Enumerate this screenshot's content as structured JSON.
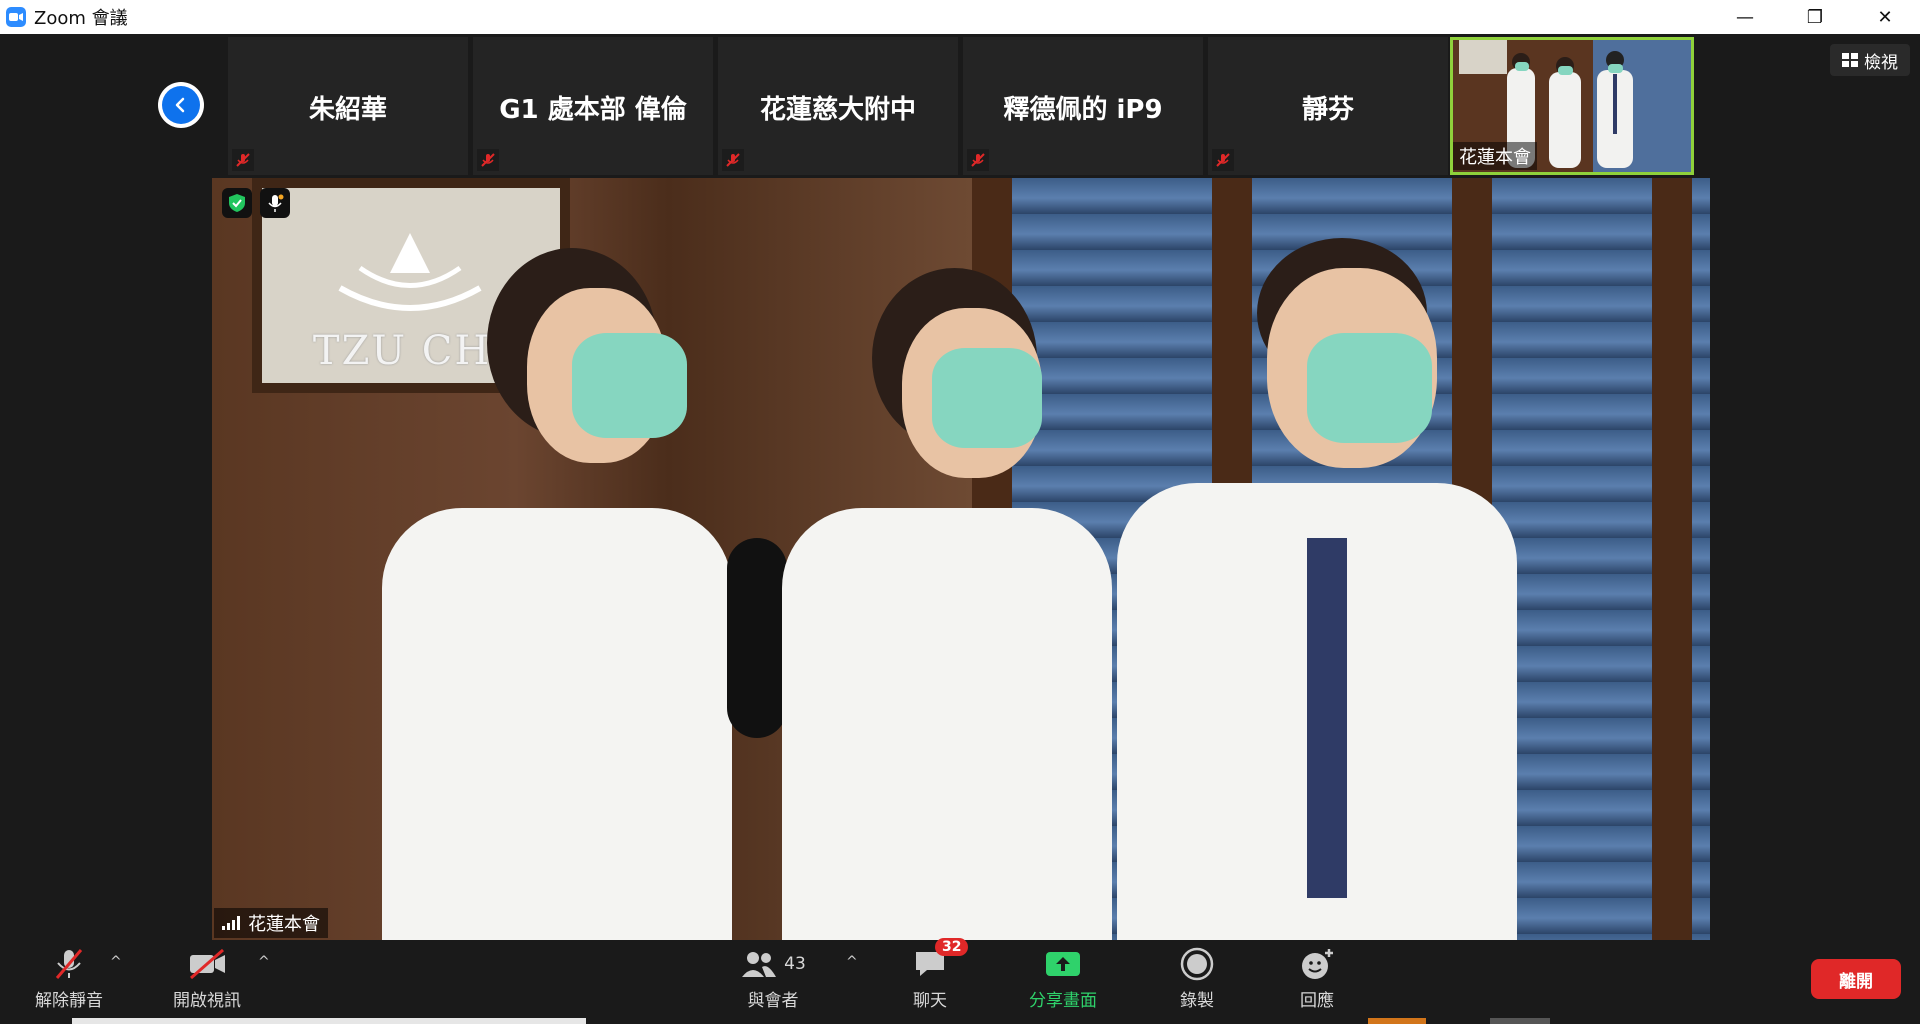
{
  "window": {
    "title": "Zoom 會議",
    "minimize_symbol": "—",
    "restore_symbol": "❐",
    "close_symbol": "✕"
  },
  "view_button": {
    "label": "檢視",
    "icon": "grid-icon"
  },
  "thumbnails": [
    {
      "name": "朱紹華",
      "muted": true
    },
    {
      "name": "G1 處本部 偉倫",
      "muted": true
    },
    {
      "name": "花蓮慈大附中",
      "muted": true
    },
    {
      "name": "釋德佩的 iP9",
      "muted": true
    },
    {
      "name": "靜芬",
      "muted": true
    }
  ],
  "active_thumbnail": {
    "name": "花蓮本會"
  },
  "main_video": {
    "participant_name": "花蓮本會",
    "plaque_text": "TZU CHI",
    "encrypted": true,
    "speaking": true
  },
  "toolbar": {
    "unmute": {
      "label": "解除靜音",
      "icon": "muted-mic-icon"
    },
    "start_video": {
      "label": "開啟視訊",
      "icon": "video-off-icon"
    },
    "participants": {
      "label": "與會者",
      "count": "43",
      "icon": "participants-icon"
    },
    "chat": {
      "label": "聊天",
      "unread": "32",
      "icon": "chat-icon"
    },
    "share": {
      "label": "分享畫面",
      "icon": "share-screen-icon",
      "color": "#2fd26b"
    },
    "record": {
      "label": "錄製",
      "icon": "record-icon"
    },
    "reactions": {
      "label": "回應",
      "icon": "reaction-icon"
    },
    "leave": {
      "label": "離開",
      "color": "#e02828"
    },
    "caret_symbol": "^"
  }
}
